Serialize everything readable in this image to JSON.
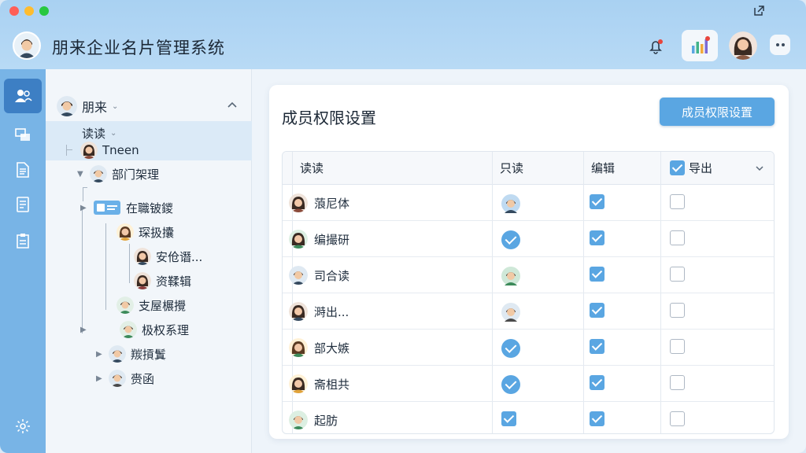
{
  "app": {
    "title": "朋来企业名片管理系统",
    "accent": "#5aa6e2",
    "icons": [
      "bell-icon",
      "chart-icon",
      "more-icon",
      "external-link-icon"
    ]
  },
  "rail": {
    "items": [
      {
        "icon": "contacts-icon",
        "active": true
      },
      {
        "icon": "cards-icon",
        "active": false
      },
      {
        "icon": "document-icon",
        "active": false
      },
      {
        "icon": "notes-icon",
        "active": false
      },
      {
        "icon": "clipboard-icon",
        "active": false
      },
      {
        "icon": "settings-icon",
        "active": false
      }
    ]
  },
  "tree": {
    "root": "朋来",
    "nodes": [
      {
        "label": "读读"
      },
      {
        "label": "Tneen"
      },
      {
        "label": "部门架理"
      },
      {
        "label": "在職铍鑁"
      },
      {
        "label": "琛扱攮"
      },
      {
        "label": "安伧谮..."
      },
      {
        "label": "资鞣辑"
      },
      {
        "label": "支屋榐攪"
      },
      {
        "label": "极权系理"
      },
      {
        "label": "羰摃鬒"
      },
      {
        "label": "赍函"
      }
    ]
  },
  "panel": {
    "title": "成员权限设置",
    "button": "成员权限设置",
    "columns": {
      "name": "读读",
      "readonly": "只读",
      "edit": "编辑",
      "export": "导出"
    },
    "rows": [
      {
        "name": "蒗尼体",
        "readonly": "avatar",
        "edit": true,
        "export": false
      },
      {
        "name": "编撮研",
        "readonly": "check",
        "edit": true,
        "export": false
      },
      {
        "name": "司合读",
        "readonly": "avatar",
        "edit": true,
        "export": false
      },
      {
        "name": "溡出...",
        "readonly": "avatar",
        "edit": true,
        "export": false
      },
      {
        "name": "部大嫉",
        "readonly": "check",
        "edit": true,
        "export": false
      },
      {
        "name": "斋柤共",
        "readonly": "check",
        "edit": true,
        "export": false
      },
      {
        "name": "起肪",
        "readonly": "box",
        "edit": true,
        "export": false
      }
    ]
  }
}
